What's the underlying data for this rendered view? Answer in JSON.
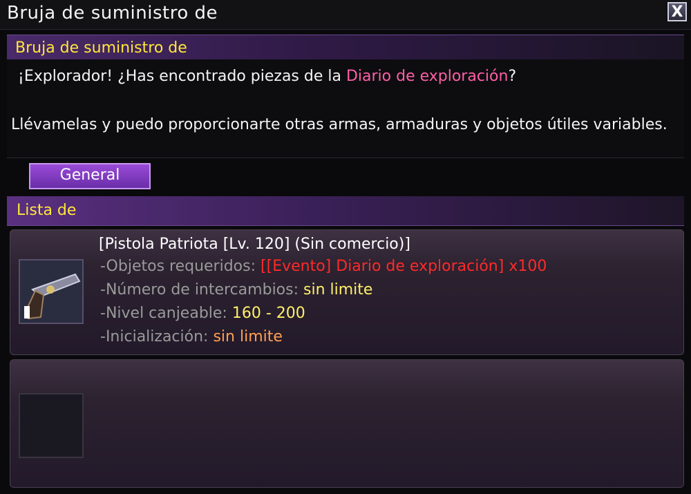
{
  "window": {
    "title": "Bruja de suministro de",
    "close_label": "X"
  },
  "npc": {
    "name": "Bruja de suministro de",
    "line1_pre": "¡Explorador! ¿Has encontrado piezas de la ",
    "line1_highlight": "Diario de exploración",
    "line1_post": "?",
    "line2": "Llévamelas y puedo proporcionarte otras armas, armaduras y objetos útiles variables."
  },
  "tabs": [
    {
      "label": "General",
      "active": true
    }
  ],
  "list": {
    "header": "Lista de",
    "items": [
      {
        "name": "[Pistola Patriota [Lv. 120] (Sin comercio)]",
        "icon": "pistol-icon",
        "required_label": "-Objetos requeridos:",
        "required_value": "[[Evento] Diario de exploración] x100",
        "exchanges_label": "-Número de intercambios:",
        "exchanges_value": "sin limite",
        "level_label": "-Nivel canjeable:",
        "level_value": "160 - 200",
        "init_label": "-Inicialización:",
        "init_value": "sin limite"
      }
    ]
  },
  "colors": {
    "accent_purple": "#6a2ea8",
    "header_text": "#ffe73a",
    "highlight_pink": "#ff5fa6",
    "required_red": "#ff2a2a",
    "value_yellow": "#fff06a",
    "value_orange": "#ffa050"
  }
}
